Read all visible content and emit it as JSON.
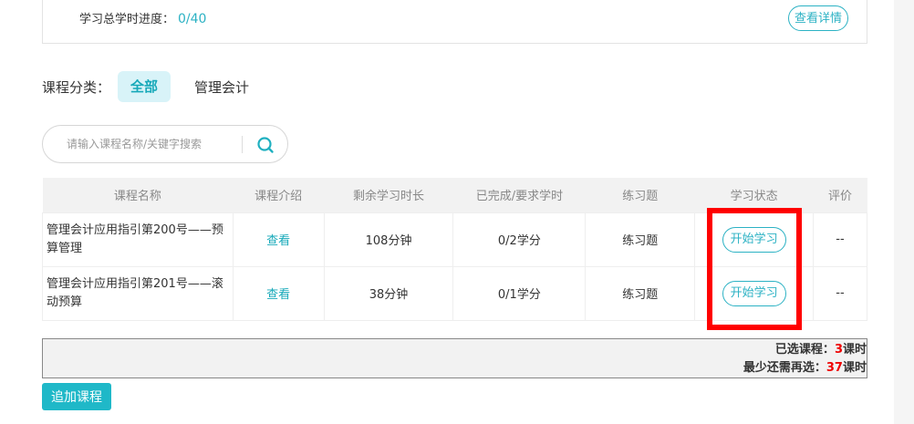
{
  "progress": {
    "label": "学习总学时进度：",
    "value": "0/40",
    "detail_button": "查看详情"
  },
  "category": {
    "label": "课程分类：",
    "items": [
      "全部",
      "管理会计"
    ]
  },
  "search": {
    "placeholder": "请输入课程名称/关键字搜索"
  },
  "table": {
    "headers": [
      "课程名称",
      "课程介绍",
      "剩余学习时长",
      "已完成/要求学时",
      "练习题",
      "学习状态",
      "评价"
    ],
    "rows": [
      {
        "name": "管理会计应用指引第200号——预算管理",
        "intro": "查看",
        "remaining": "108分钟",
        "completed": "0/2学分",
        "practice": "练习题",
        "status": "开始学习",
        "rating": "--"
      },
      {
        "name": "管理会计应用指引第201号——滚动预算",
        "intro": "查看",
        "remaining": "38分钟",
        "completed": "0/1学分",
        "practice": "练习题",
        "status": "开始学习",
        "rating": "--"
      }
    ]
  },
  "summary": {
    "selected_label": "已选课程：",
    "selected_value": "3",
    "unit": "课时",
    "need_label": "最少还需再选：",
    "need_value": "37"
  },
  "add_button": "追加课程"
}
